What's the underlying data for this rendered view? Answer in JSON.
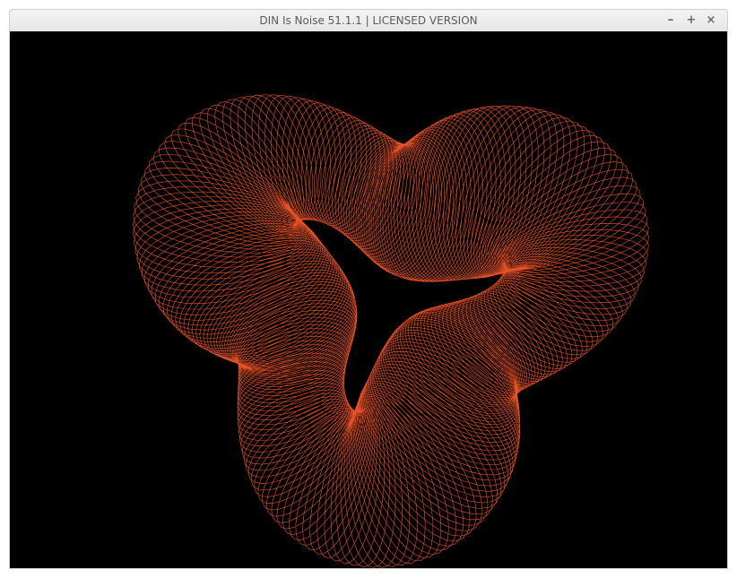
{
  "window": {
    "title": "DIN Is Noise 51.1.1 | LICENSED VERSION",
    "controls": {
      "minimize": "–",
      "maximize": "+",
      "close": "×"
    }
  },
  "visualization": {
    "background_color": "#000000",
    "stroke_color": "#ff5a2a",
    "icon": "spirograph-wireframe-pattern"
  }
}
